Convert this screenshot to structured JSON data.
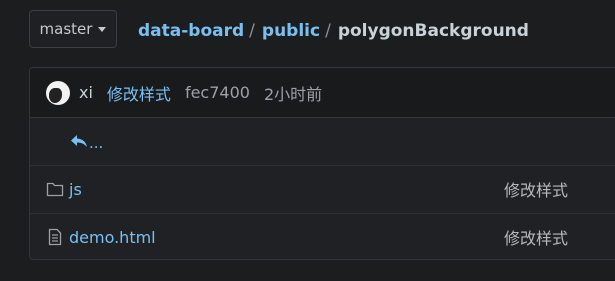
{
  "branch": {
    "label": "master"
  },
  "breadcrumb": {
    "repo": "data-board",
    "folder": "public",
    "current": "polygonBackground",
    "sep1": "/",
    "sep2": "/"
  },
  "commit": {
    "author": "xi",
    "message": "修改样式",
    "sha": "fec7400",
    "time": "2小时前"
  },
  "parent_link": {
    "label": "..."
  },
  "files": [
    {
      "name": "js",
      "type": "folder",
      "icon": "folder-icon",
      "message": "修改样式"
    },
    {
      "name": "demo.html",
      "type": "file",
      "icon": "file-text-icon",
      "message": "修改样式"
    }
  ],
  "colors": {
    "link": "#79c0f0",
    "background": "#1c1d1f"
  }
}
